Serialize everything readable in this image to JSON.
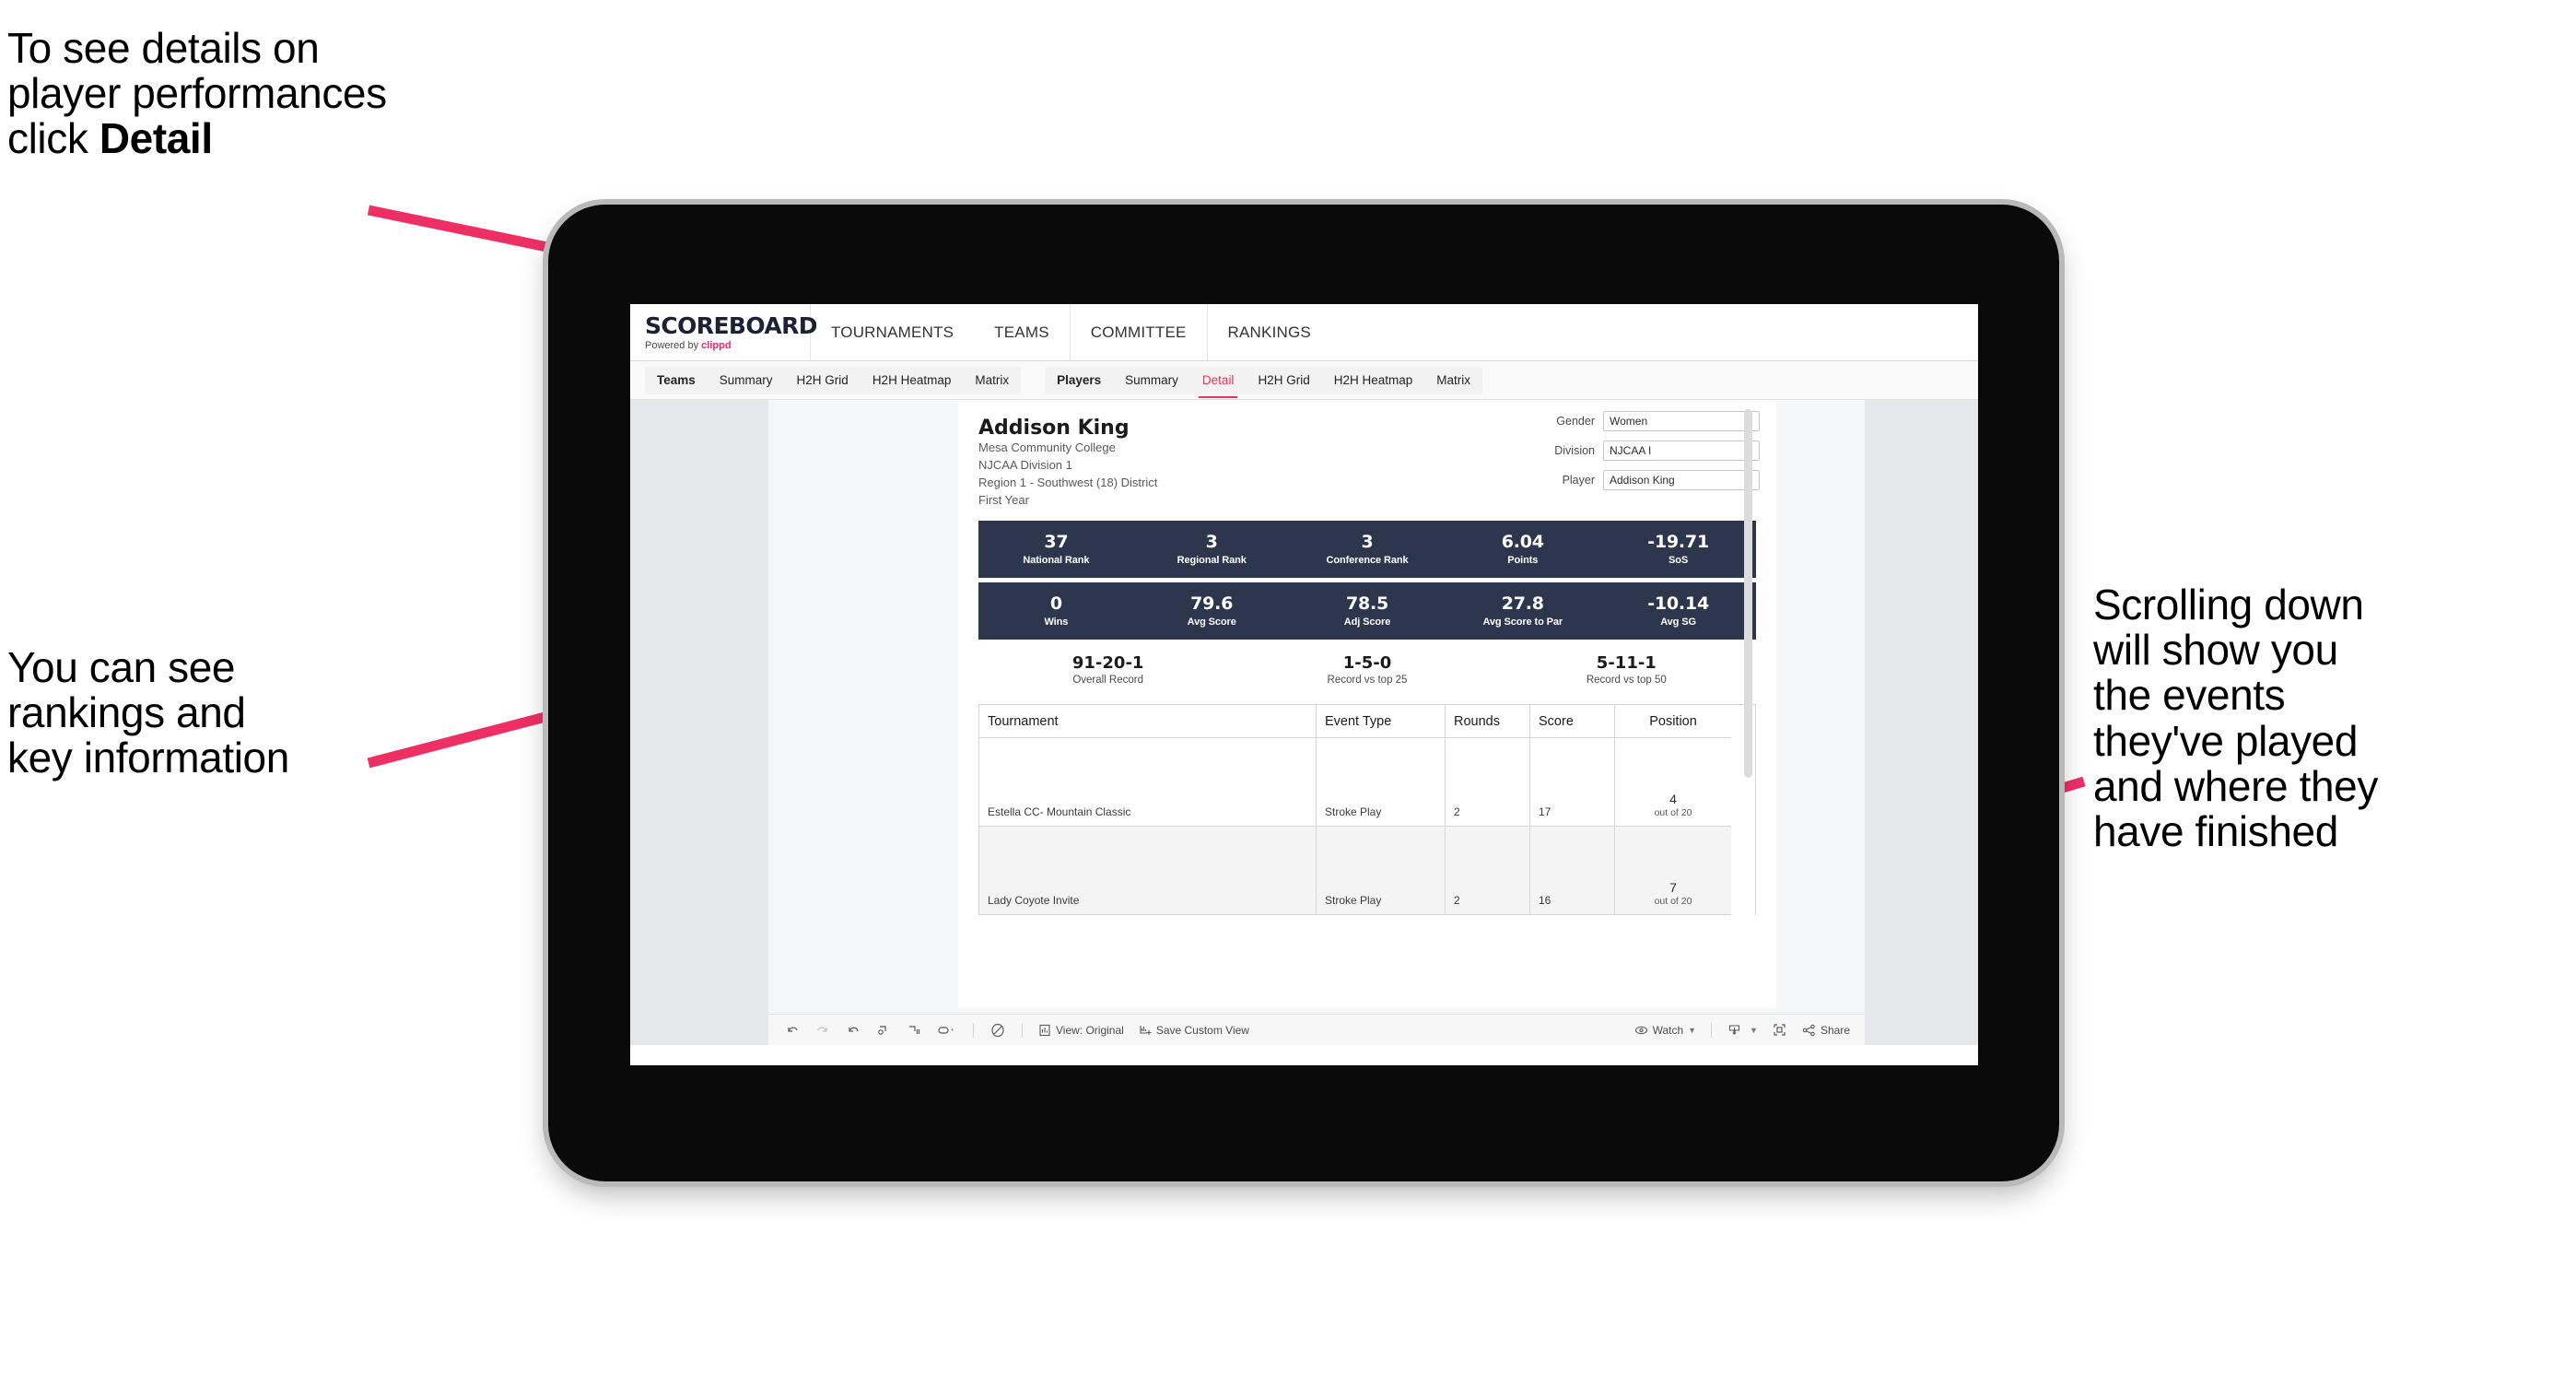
{
  "annotations": {
    "top_left": "To see details on\nplayer performances\nclick ",
    "top_left_bold": "Detail",
    "mid_left": "You can see\nrankings and\nkey information",
    "right": "Scrolling down\nwill show you\nthe events\nthey've played\nand where they\nhave finished",
    "arrow_color": "#ed2f64"
  },
  "app": {
    "brand": {
      "title": "SCOREBOARD",
      "powered_prefix": "Powered by ",
      "powered_name": "clippd"
    },
    "top_nav": [
      "TOURNAMENTS",
      "TEAMS",
      "COMMITTEE",
      "RANKINGS"
    ],
    "sub_nav_group_1": [
      "Teams",
      "Summary",
      "H2H Grid",
      "H2H Heatmap",
      "Matrix"
    ],
    "sub_nav_group_2": [
      "Players",
      "Summary",
      "Detail",
      "H2H Grid",
      "H2H Heatmap",
      "Matrix"
    ],
    "active_sub_tab": "Detail",
    "accent_color": "#e5355f"
  },
  "player": {
    "name": "Addison King",
    "school": "Mesa Community College",
    "division": "NJCAA Division 1",
    "region": "Region 1 - Southwest (18) District",
    "year": "First Year"
  },
  "selectors": [
    {
      "label": "Gender",
      "value": "Women"
    },
    {
      "label": "Division",
      "value": "NJCAA I"
    },
    {
      "label": "Player",
      "value": "Addison King"
    }
  ],
  "stats_row_1": [
    {
      "value": "37",
      "label": "National Rank"
    },
    {
      "value": "3",
      "label": "Regional Rank"
    },
    {
      "value": "3",
      "label": "Conference Rank"
    },
    {
      "value": "6.04",
      "label": "Points"
    },
    {
      "value": "-19.71",
      "label": "SoS"
    }
  ],
  "stats_row_2": [
    {
      "value": "0",
      "label": "Wins"
    },
    {
      "value": "79.6",
      "label": "Avg Score"
    },
    {
      "value": "78.5",
      "label": "Adj Score"
    },
    {
      "value": "27.8",
      "label": "Avg Score to Par"
    },
    {
      "value": "-10.14",
      "label": "Avg SG"
    }
  ],
  "records": [
    {
      "value": "91-20-1",
      "label": "Overall Record"
    },
    {
      "value": "1-5-0",
      "label": "Record vs top 25"
    },
    {
      "value": "5-11-1",
      "label": "Record vs top 50"
    }
  ],
  "tournament_table": {
    "headers": [
      "Tournament",
      "Event Type",
      "Rounds",
      "Score",
      "Position"
    ],
    "rows": [
      {
        "tournament": "Estella CC- Mountain Classic",
        "event_type": "Stroke Play",
        "rounds": "2",
        "score": "17",
        "position": "4",
        "position_sub": "out of 20"
      },
      {
        "tournament": "Lady Coyote Invite",
        "event_type": "Stroke Play",
        "rounds": "2",
        "score": "16",
        "position": "7",
        "position_sub": "out of 20"
      }
    ]
  },
  "toolbar": {
    "view_label": "View: Original",
    "save_label": "Save Custom View",
    "watch_label": "Watch",
    "share_label": "Share"
  }
}
